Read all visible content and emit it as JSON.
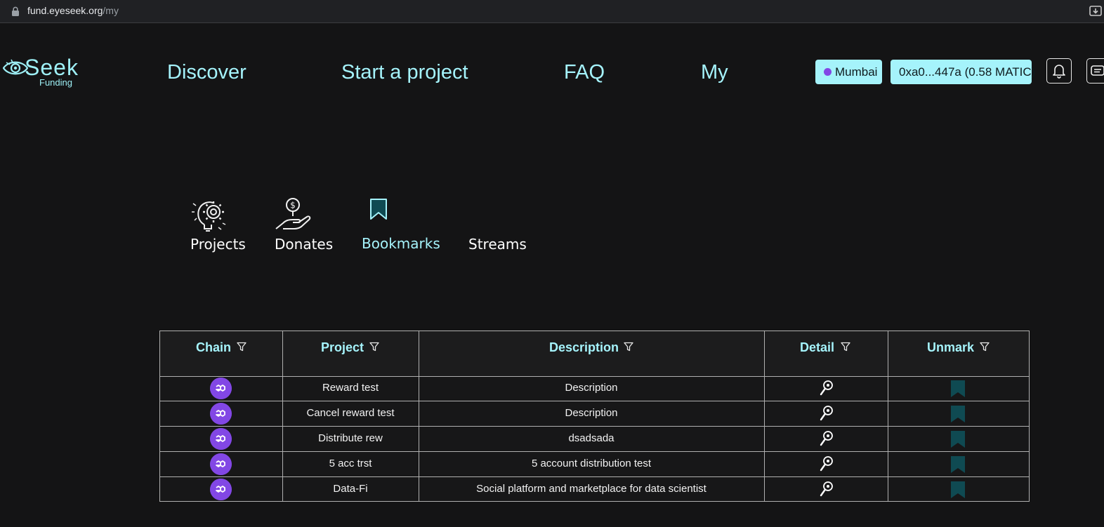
{
  "browser": {
    "url_host": "fund.eyeseek.org",
    "url_path": "/my"
  },
  "header": {
    "logo_seek": "Seek",
    "logo_funding": "Funding",
    "nav": [
      "Discover",
      "Start a project",
      "FAQ",
      "My"
    ],
    "network_label": "Mumbai",
    "wallet_label": "0xa0...447a (0.58 MATIC)"
  },
  "tabs": [
    {
      "label": "Projects",
      "icon": "projects-gear-bulb-icon"
    },
    {
      "label": "Donates",
      "icon": "donate-hand-coin-icon"
    },
    {
      "label": "Bookmarks",
      "icon": "bookmark-icon",
      "active": true
    },
    {
      "label": "Streams",
      "icon": ""
    }
  ],
  "table": {
    "columns": [
      "Chain",
      "Project",
      "Description",
      "Detail",
      "Unmark"
    ],
    "rows": [
      {
        "chain": "polygon",
        "project": "Reward test",
        "description": "Description"
      },
      {
        "chain": "polygon",
        "project": "Cancel reward test",
        "description": "Description"
      },
      {
        "chain": "polygon",
        "project": "Distribute rew",
        "description": "dsadsada"
      },
      {
        "chain": "polygon",
        "project": "5 acc trst",
        "description": "5 account distribution test"
      },
      {
        "chain": "polygon",
        "project": "Data-Fi",
        "description": "Social platform and marketplace for data scientist"
      }
    ]
  },
  "colors": {
    "accent": "#a5f3fb",
    "background": "#141415",
    "polygon": "#8247e5",
    "bookmark": "#0f4a52"
  }
}
